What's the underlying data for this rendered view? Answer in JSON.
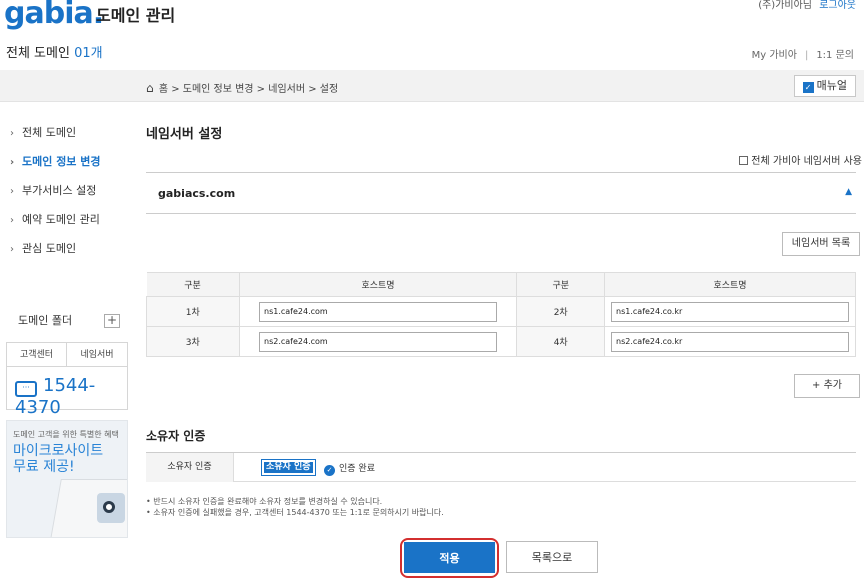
{
  "header": {
    "logo": "gabia.",
    "title": "도메인 관리",
    "user": "(주)가비아님",
    "logout": "로그아웃"
  },
  "subheader": {
    "total_label": "전체 도메인",
    "total_count": "01개",
    "my_gabia": "My 가비아",
    "sep": "|",
    "inquiry": "1:1 문의"
  },
  "breadcrumb": {
    "path": "홈 > 도메인 정보 변경 > 네임서버 > 설정",
    "manual": "매뉴얼"
  },
  "sidebar": {
    "items": [
      {
        "label": "전체 도메인"
      },
      {
        "label": "도메인 정보 변경"
      },
      {
        "label": "부가서비스 설정"
      },
      {
        "label": "예약 도메인 관리"
      },
      {
        "label": "관심 도메인"
      }
    ],
    "folder": "도메인 폴더",
    "help_tabs": [
      "고객센터",
      "네임서버"
    ],
    "phone": "1544-4370",
    "promo_small": "도메인 고객을 위한 특별한 혜택",
    "promo_line1": "마이크로사이트",
    "promo_line2": "무료 제공!"
  },
  "main": {
    "title": "네임서버 설정",
    "all_gabia_ns": "전체 가비아 네임서버 사용",
    "domain": "gabiacs.com",
    "ns_list_button": "네임서버 목록",
    "table": {
      "headers": [
        "구분",
        "호스트명",
        "구분",
        "호스트명"
      ],
      "rows": [
        {
          "l1": "1차",
          "h1": "ns1.cafe24.com",
          "l2": "2차",
          "h2": "ns1.cafe24.co.kr"
        },
        {
          "l1": "3차",
          "h1": "ns2.cafe24.com",
          "l2": "4차",
          "h2": "ns2.cafe24.co.kr"
        }
      ]
    },
    "add_button": "+ 추가",
    "owner_title": "소유자 인증",
    "owner_label": "소유자 인증",
    "owner_button": "소유자 인증",
    "owner_status": "인증 완료",
    "notes": [
      "• 반드시 소유자 인증을 완료해야 소유자 정보를 변경하실 수 있습니다.",
      "• 소유자 인증에 실패했을 경우, 고객센터 1544-4370 또는 1:1로 문의하시기 바랍니다."
    ],
    "apply": "적용",
    "back": "목록으로"
  }
}
